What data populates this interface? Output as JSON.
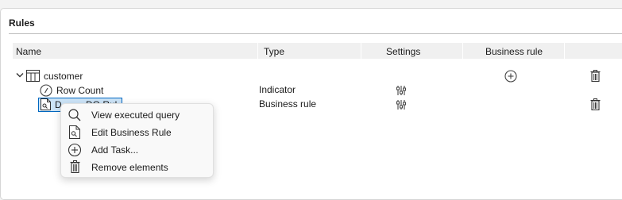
{
  "panel": {
    "title": "Rules"
  },
  "columns": {
    "name": "Name",
    "type": "Type",
    "settings": "Settings",
    "business_rule": "Business rule"
  },
  "tree": {
    "root": {
      "label": "customer"
    },
    "children": [
      {
        "label": "Row Count",
        "type": "Indicator"
      },
      {
        "label_visible_start": "D",
        "label_visible_end": "DQ Rul",
        "type": "Business rule"
      }
    ]
  },
  "context_menu": {
    "items": [
      {
        "label": "View executed query",
        "icon": "search-icon"
      },
      {
        "label": "Edit Business Rule",
        "icon": "rule-document-icon"
      },
      {
        "label": "Add Task...",
        "icon": "add-circle-icon"
      },
      {
        "label": "Remove elements",
        "icon": "trash-icon"
      }
    ]
  },
  "colors": {
    "selection_border": "#0067c0",
    "selection_fill": "#cce4f7",
    "header_bg": "#f0f0f0"
  }
}
